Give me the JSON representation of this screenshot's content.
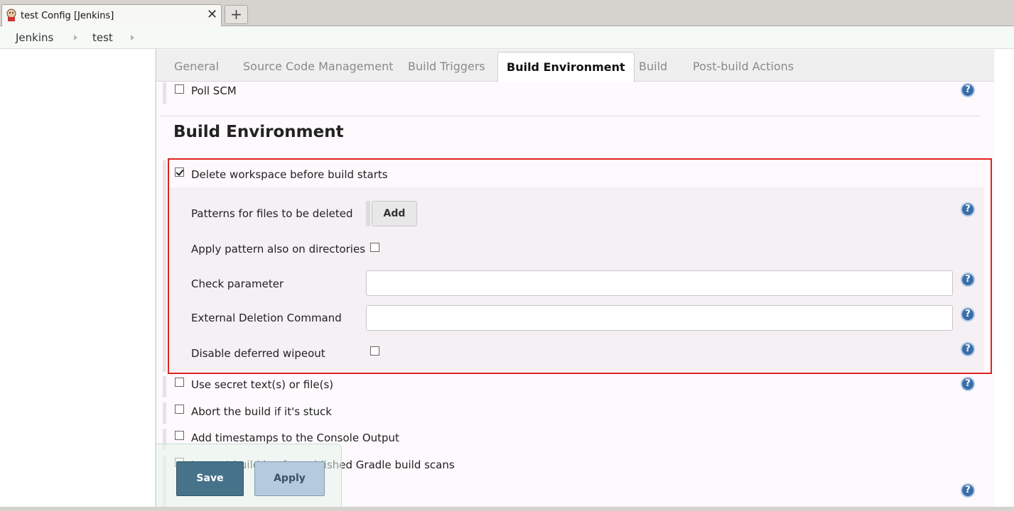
{
  "browser": {
    "tab_title": "test Config [Jenkins]",
    "close_glyph": "✕",
    "new_tab_glyph": "+"
  },
  "breadcrumbs": [
    "Jenkins",
    "test"
  ],
  "config_tabs": [
    {
      "label": "General",
      "active": false
    },
    {
      "label": "Source Code Management",
      "active": false
    },
    {
      "label": "Build Triggers",
      "active": false
    },
    {
      "label": "Build Environment",
      "active": true
    },
    {
      "label": "Build",
      "active": false
    },
    {
      "label": "Post-build Actions",
      "active": false
    }
  ],
  "triggers": {
    "poll_scm": {
      "label": "Poll SCM",
      "checked": false
    }
  },
  "build_env": {
    "title": "Build Environment",
    "delete_workspace": {
      "label": "Delete workspace before build starts",
      "checked": true
    },
    "patterns_label": "Patterns for files to be deleted",
    "add_button": "Add",
    "apply_pattern": {
      "label": "Apply pattern also on directories",
      "checked": false
    },
    "check_parameter": {
      "label": "Check parameter",
      "value": ""
    },
    "external_deletion": {
      "label": "External Deletion Command",
      "value": ""
    },
    "disable_deferred": {
      "label": "Disable deferred wipeout",
      "checked": false
    },
    "secret": {
      "label": "Use secret text(s) or file(s)",
      "checked": false
    },
    "abort_stuck": {
      "label": "Abort the build if it's stuck",
      "checked": false
    },
    "timestamps": {
      "label": "Add timestamps to the Console Output",
      "checked": false
    },
    "gradle": {
      "label": "Inspect build log for published Gradle build scans",
      "checked": false
    }
  },
  "help_glyph": "?",
  "actions": {
    "save": "Save",
    "apply": "Apply"
  },
  "colors": {
    "highlight_border": "#dd2222",
    "save_button": "#467389",
    "apply_button": "#b5cbdd",
    "help_icon": "#3a6ea8"
  }
}
